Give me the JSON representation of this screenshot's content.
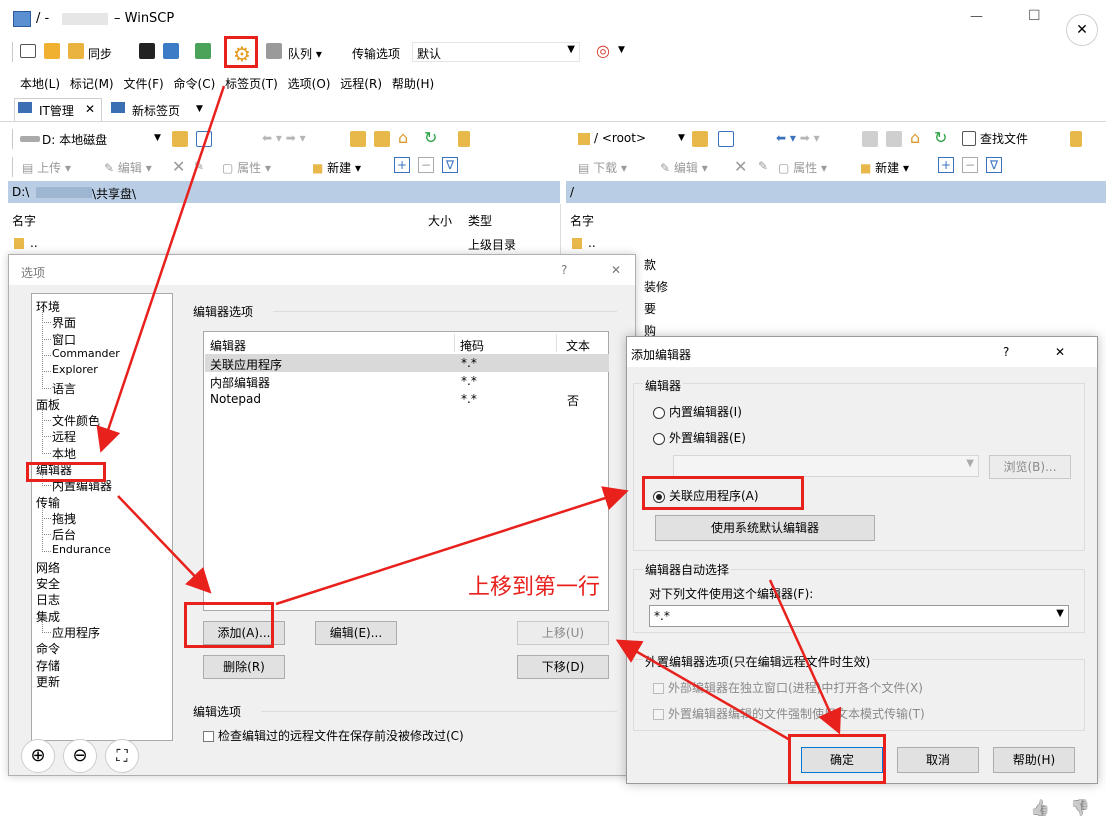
{
  "window": {
    "title_prefix": "/ -",
    "title_suffix": "– WinSCP",
    "min": "—",
    "max": "☐",
    "close": "✕"
  },
  "toolbar": {
    "sync": "同步",
    "queue": "队列 ▾",
    "transfer_options": "传输选项",
    "transfer_value": "默认"
  },
  "menu": [
    "本地(L)",
    "标记(M)",
    "文件(F)",
    "命令(C)",
    "标签页(T)",
    "选项(O)",
    "远程(R)",
    "帮助(H)"
  ],
  "tabs": {
    "active": "IT管理",
    "new": "新标签页"
  },
  "left_panel": {
    "drive": "D: 本地磁盘",
    "upload": "上传",
    "edit": "编辑",
    "properties": "属性",
    "new": "新建",
    "path_start": "D:\\",
    "path_end": "\\共享盘\\",
    "col_name": "名字",
    "col_size": "大小",
    "col_type": "类型",
    "parent_name": "..",
    "parent_type": "上级目录"
  },
  "right_panel": {
    "root": "/ <root>",
    "find": "查找文件",
    "download": "下载",
    "edit": "编辑",
    "properties": "属性",
    "new": "新建",
    "path": "/",
    "col_name": "名字",
    "parent_name": "..",
    "partial_items": [
      "款",
      "装修",
      "要",
      "购"
    ]
  },
  "options_dialog": {
    "title": "选项",
    "help": "?",
    "close": "✕",
    "tree": [
      {
        "label": "环境",
        "level": 0
      },
      {
        "label": "界面",
        "level": 1
      },
      {
        "label": "窗口",
        "level": 1
      },
      {
        "label": "Commander",
        "level": 2
      },
      {
        "label": "Explorer",
        "level": 2
      },
      {
        "label": "语言",
        "level": 1
      },
      {
        "label": "面板",
        "level": 0
      },
      {
        "label": "文件颜色",
        "level": 1
      },
      {
        "label": "远程",
        "level": 1
      },
      {
        "label": "本地",
        "level": 1
      },
      {
        "label": "编辑器",
        "level": 0
      },
      {
        "label": "内置编辑器",
        "level": 1
      },
      {
        "label": "传输",
        "level": 0
      },
      {
        "label": "拖拽",
        "level": 1
      },
      {
        "label": "后台",
        "level": 1
      },
      {
        "label": "Endurance",
        "level": 1
      },
      {
        "label": "网络",
        "level": 0
      },
      {
        "label": "安全",
        "level": 0
      },
      {
        "label": "日志",
        "level": 0
      },
      {
        "label": "集成",
        "level": 0
      },
      {
        "label": "应用程序",
        "level": 1
      },
      {
        "label": "命令",
        "level": 0
      },
      {
        "label": "存储",
        "level": 0
      },
      {
        "label": "更新",
        "level": 0
      }
    ],
    "editor_section": "编辑器选项",
    "table_headers": [
      "编辑器",
      "掩码",
      "文本"
    ],
    "table_rows": [
      {
        "editor": "关联应用程序",
        "mask": "*.*",
        "text": ""
      },
      {
        "editor": "内部编辑器",
        "mask": "*.*",
        "text": ""
      },
      {
        "editor": "Notepad",
        "mask": "*.*",
        "text": "否"
      }
    ],
    "add": "添加(A)...",
    "edit": "编辑(E)...",
    "up": "上移(U)",
    "delete": "删除(R)",
    "down": "下移(D)",
    "edit_options_section": "编辑选项",
    "check_modified": "检查编辑过的远程文件在保存前没被修改过(C)",
    "zoom_in": "⊕",
    "zoom_out": "⊖",
    "fit": "⛶"
  },
  "add_editor_dialog": {
    "title": "添加编辑器",
    "help": "?",
    "close": "✕",
    "editor_section": "编辑器",
    "internal": "内置编辑器(I)",
    "external": "外置编辑器(E)",
    "browse": "浏览(B)...",
    "associated": "关联应用程序(A)",
    "use_default": "使用系统默认编辑器",
    "auto_section": "编辑器自动选择",
    "use_for_label": "对下列文件使用这个编辑器(F):",
    "mask_value": "*.*",
    "external_options": "外置编辑器选项(只在编辑远程文件时生效)",
    "opt1": "外部编辑器在独立窗口(进程)中打开各个文件(X)",
    "opt2": "外置编辑器编辑的文件强制使用文本模式传输(T)",
    "ok": "确定",
    "cancel": "取消",
    "help_btn": "帮助(H)"
  },
  "annotation": {
    "move_up": "上移到第一行"
  },
  "footer": {
    "like": "👍",
    "dislike": "👎"
  },
  "colors": {
    "accent": "#e8211d",
    "path_bar": "#b9cde5",
    "selected_row": "#d9d9d9"
  }
}
